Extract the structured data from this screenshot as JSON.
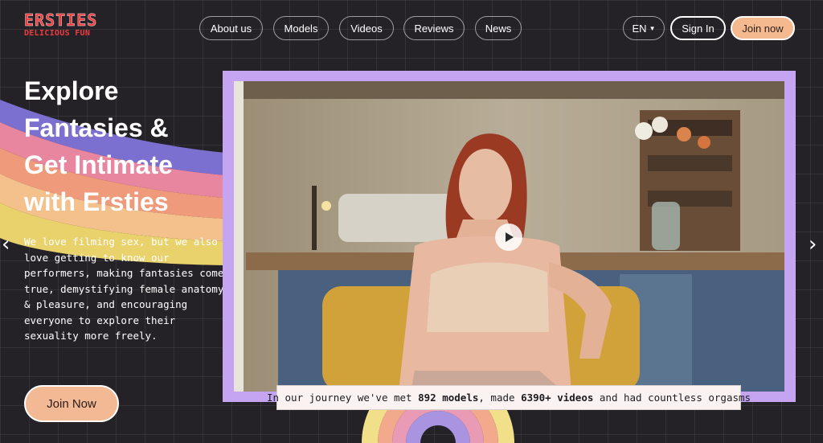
{
  "logo": {
    "title": "ERSTIES",
    "tagline": "DELICIOUS FUN"
  },
  "nav": {
    "items": [
      {
        "label": "About us"
      },
      {
        "label": "Models"
      },
      {
        "label": "Videos"
      },
      {
        "label": "Reviews"
      },
      {
        "label": "News"
      }
    ],
    "language": "EN",
    "sign_in": "Sign In",
    "join": "Join now"
  },
  "hero": {
    "headline_lines": [
      "Explore",
      "Fantasies &",
      "Get Intimate",
      "with Ersties"
    ],
    "description": "We love filming sex, but we also love getting to know our performers, making fantasies come true, demystifying female anatomy & pleasure, and encouraging everyone to explore their sexuality more freely.",
    "cta": "Join Now"
  },
  "stats": {
    "prefix": "In our journey we've met",
    "models": "892 models",
    "middle": ", made",
    "videos": "6390+ videos",
    "suffix": "and had countless orgasms"
  },
  "icons": {
    "prev": "chevron-left-icon",
    "next": "chevron-right-icon",
    "play": "play-icon",
    "dropdown": "caret-down-icon"
  },
  "colors": {
    "background": "#242227",
    "accent": "#f4b98e",
    "brand": "#ef3b3f",
    "frame": "#c5a4f2",
    "rainbow": [
      "#7b6fd0",
      "#e9869f",
      "#ef9a7a",
      "#f4c08b",
      "#e9d26c"
    ]
  }
}
